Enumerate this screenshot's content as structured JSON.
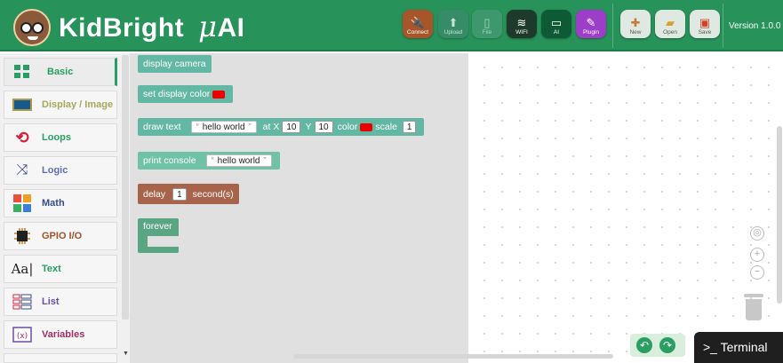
{
  "header": {
    "brand": "KidBright",
    "brand_mu": "μ",
    "brand_ai": "AI",
    "version": "Version 1.0.0",
    "buttons": [
      {
        "label": "Connect",
        "icon": "plug-icon",
        "color": "#a8552a"
      },
      {
        "label": "Upload",
        "icon": "upload-icon",
        "color": "#3a8a6a"
      },
      {
        "label": "File",
        "icon": "file-icon",
        "color": "#4e9c7c"
      },
      {
        "label": "WIFI",
        "icon": "wifi-icon",
        "color": "#1e3a2a"
      },
      {
        "label": "AI",
        "icon": "ai-icon",
        "color": "#0e5a34"
      },
      {
        "label": "Plugin",
        "icon": "plugin-icon",
        "color": "#9d3ec9"
      },
      {
        "label": "New",
        "icon": "new-file-icon",
        "color": "#dfe9e1"
      },
      {
        "label": "Open",
        "icon": "open-folder-icon",
        "color": "#dfe9e1"
      },
      {
        "label": "Save",
        "icon": "save-icon",
        "color": "#dfe9e1"
      }
    ]
  },
  "categories": [
    {
      "label": "Basic",
      "icon": "grid-icon",
      "color": "#2a9d63"
    },
    {
      "label": "Display / Image",
      "icon": "display-icon",
      "color": "#a5a85a"
    },
    {
      "label": "Loops",
      "icon": "loop-icon",
      "color": "#2a9d63"
    },
    {
      "label": "Logic",
      "icon": "shuffle-icon",
      "color": "#5b6fb0"
    },
    {
      "label": "Math",
      "icon": "math-icon",
      "color": "#3a4a8a"
    },
    {
      "label": "GPIO I/O",
      "icon": "chip-icon",
      "color": "#a0522d"
    },
    {
      "label": "Text",
      "icon": "text-icon",
      "color": "#2a9d63"
    },
    {
      "label": "List",
      "icon": "list-icon",
      "color": "#6a4fa0"
    },
    {
      "label": "Variables",
      "icon": "variables-icon",
      "color": "#a03060"
    }
  ],
  "blocks": {
    "display_camera": "display camera",
    "set_display_color": "set display color",
    "draw_text": {
      "label": "draw text",
      "text": "hello world",
      "at_x": "at X",
      "x": "10",
      "y_label": "Y",
      "y": "10",
      "color_label": "color",
      "scale_label": "scale",
      "scale": "1"
    },
    "print_console": {
      "label": "print console",
      "text": "hello world"
    },
    "delay": {
      "label": "delay",
      "value": "1",
      "unit": "second(s)"
    },
    "forever": "forever"
  },
  "colors": {
    "basic_block": "#62b8a2",
    "print_block": "#70c2a6",
    "delay_block": "#a8644a",
    "forever_block": "#5aa583",
    "red_swatch": "#e00000",
    "header": "#27935a"
  },
  "terminal": {
    "label": ">_ Terminal"
  }
}
